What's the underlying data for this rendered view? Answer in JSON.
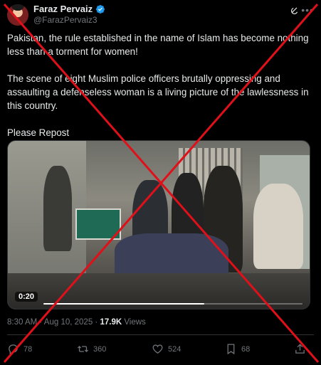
{
  "author": {
    "display_name": "Faraz Pervaiz",
    "handle": "@FarazPervaiz3",
    "verified_icon": "verified-badge-icon"
  },
  "tweet": {
    "paragraphs": [
      "Pakistan, the rule established in the name of Islam has become nothing less than a torment for women!",
      "The scene of eight Muslim police officers brutally oppressing and assaulting a defenseless woman is a living picture of the lawlessness in this country.",
      "Please Repost"
    ]
  },
  "media": {
    "duration": "0:20",
    "progress_fraction": 0.62
  },
  "meta": {
    "time": "8:30 AM",
    "separator": " · ",
    "date": "Aug 10, 2025",
    "separator2": " · ",
    "views_count": "17.9K",
    "views_label": " Views"
  },
  "actions": {
    "replies": "78",
    "reposts": "360",
    "likes": "524",
    "bookmarks": "68"
  },
  "colors": {
    "background": "#000000",
    "text": "#e7e9ea",
    "muted": "#71767b",
    "verified": "#1d9bf0",
    "overlay_cross": "#e0101a"
  }
}
